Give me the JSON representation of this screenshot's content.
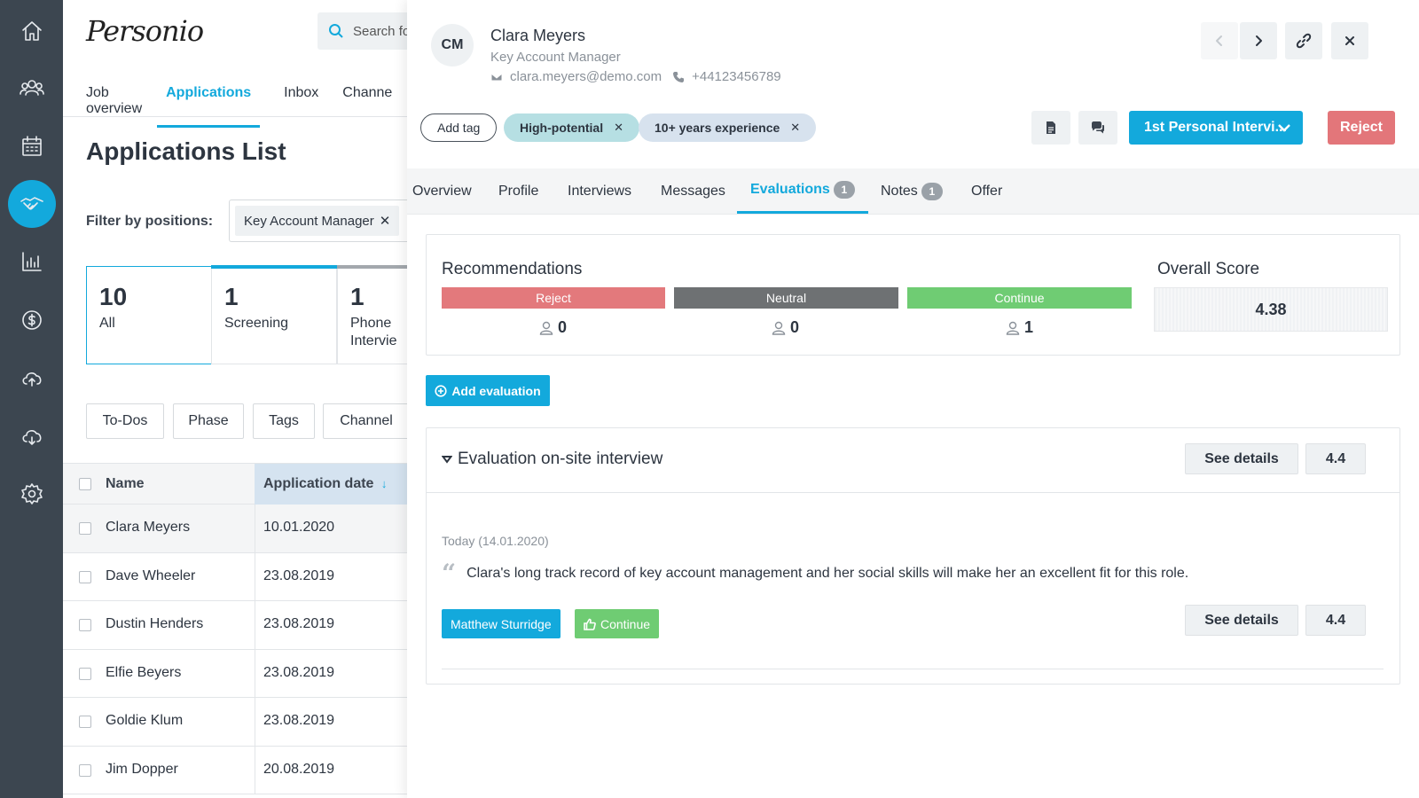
{
  "rail": {
    "items": [
      {
        "icon": "home-icon"
      },
      {
        "icon": "people-icon"
      },
      {
        "icon": "calendar-icon"
      },
      {
        "icon": "handshake-icon",
        "active": true
      },
      {
        "icon": "analytics-icon"
      },
      {
        "icon": "payroll-icon"
      },
      {
        "icon": "upload-cloud-icon"
      },
      {
        "icon": "download-cloud-icon"
      },
      {
        "icon": "settings-icon"
      }
    ]
  },
  "app": {
    "logo": "Personio",
    "search_placeholder": "Search fo"
  },
  "nav": [
    "Job overview",
    "Applications",
    "Inbox",
    "Channe"
  ],
  "list": {
    "title": "Applications List",
    "filter_label": "Filter by positions:",
    "filter_chip": "Key Account Manager",
    "stages": [
      {
        "num": "10",
        "label": "All"
      },
      {
        "num": "1",
        "label": "Screening"
      },
      {
        "num": "1",
        "label": "Phone Intervie"
      }
    ],
    "filter_buttons": [
      "To-Dos",
      "Phase",
      "Tags",
      "Channel"
    ],
    "columns": {
      "name": "Name",
      "date": "Application date"
    },
    "rows": [
      {
        "name": "Clara Meyers",
        "date": "10.01.2020"
      },
      {
        "name": "Dave Wheeler",
        "date": "23.08.2019"
      },
      {
        "name": "Dustin Henders",
        "date": "23.08.2019"
      },
      {
        "name": "Elfie Beyers",
        "date": "23.08.2019"
      },
      {
        "name": "Goldie Klum",
        "date": "23.08.2019"
      },
      {
        "name": "Jim Dopper",
        "date": "20.08.2019"
      }
    ]
  },
  "candidate": {
    "initials": "CM",
    "name": "Clara Meyers",
    "role": "Key Account Manager",
    "email": "clara.meyers@demo.com",
    "phone": "+44123456789",
    "add_tag": "Add tag",
    "tags": [
      "High-potential",
      "10+ years experience"
    ],
    "stage_button": "1st Personal Intervi...",
    "reject_button": "Reject"
  },
  "tabs": [
    {
      "label": "Overview"
    },
    {
      "label": "Profile"
    },
    {
      "label": "Interviews"
    },
    {
      "label": "Messages"
    },
    {
      "label": "Evaluations",
      "count": "1"
    },
    {
      "label": "Notes",
      "count": "1"
    },
    {
      "label": "Offer"
    }
  ],
  "recommendations": {
    "title": "Recommendations",
    "items": [
      {
        "label": "Reject",
        "count": "0",
        "color": "#e3797c"
      },
      {
        "label": "Neutral",
        "count": "0",
        "color": "#6e7173"
      },
      {
        "label": "Continue",
        "count": "1",
        "color": "#6fcc73"
      }
    ],
    "score_title": "Overall Score",
    "score": "4.38"
  },
  "add_evaluation": "Add evaluation",
  "evaluation": {
    "title": "Evaluation on-site interview",
    "see_details": "See details",
    "score": "4.4",
    "date": "Today (14.01.2020)",
    "quote": "Clara's long track record of key account management and her social skills will make her an excellent fit for this role.",
    "evaluator": "Matthew Sturridge",
    "recommendation": "Continue"
  },
  "colors": {
    "accent": "#13a9dc",
    "rail": "#3c4650",
    "reject": "#e3767a"
  }
}
